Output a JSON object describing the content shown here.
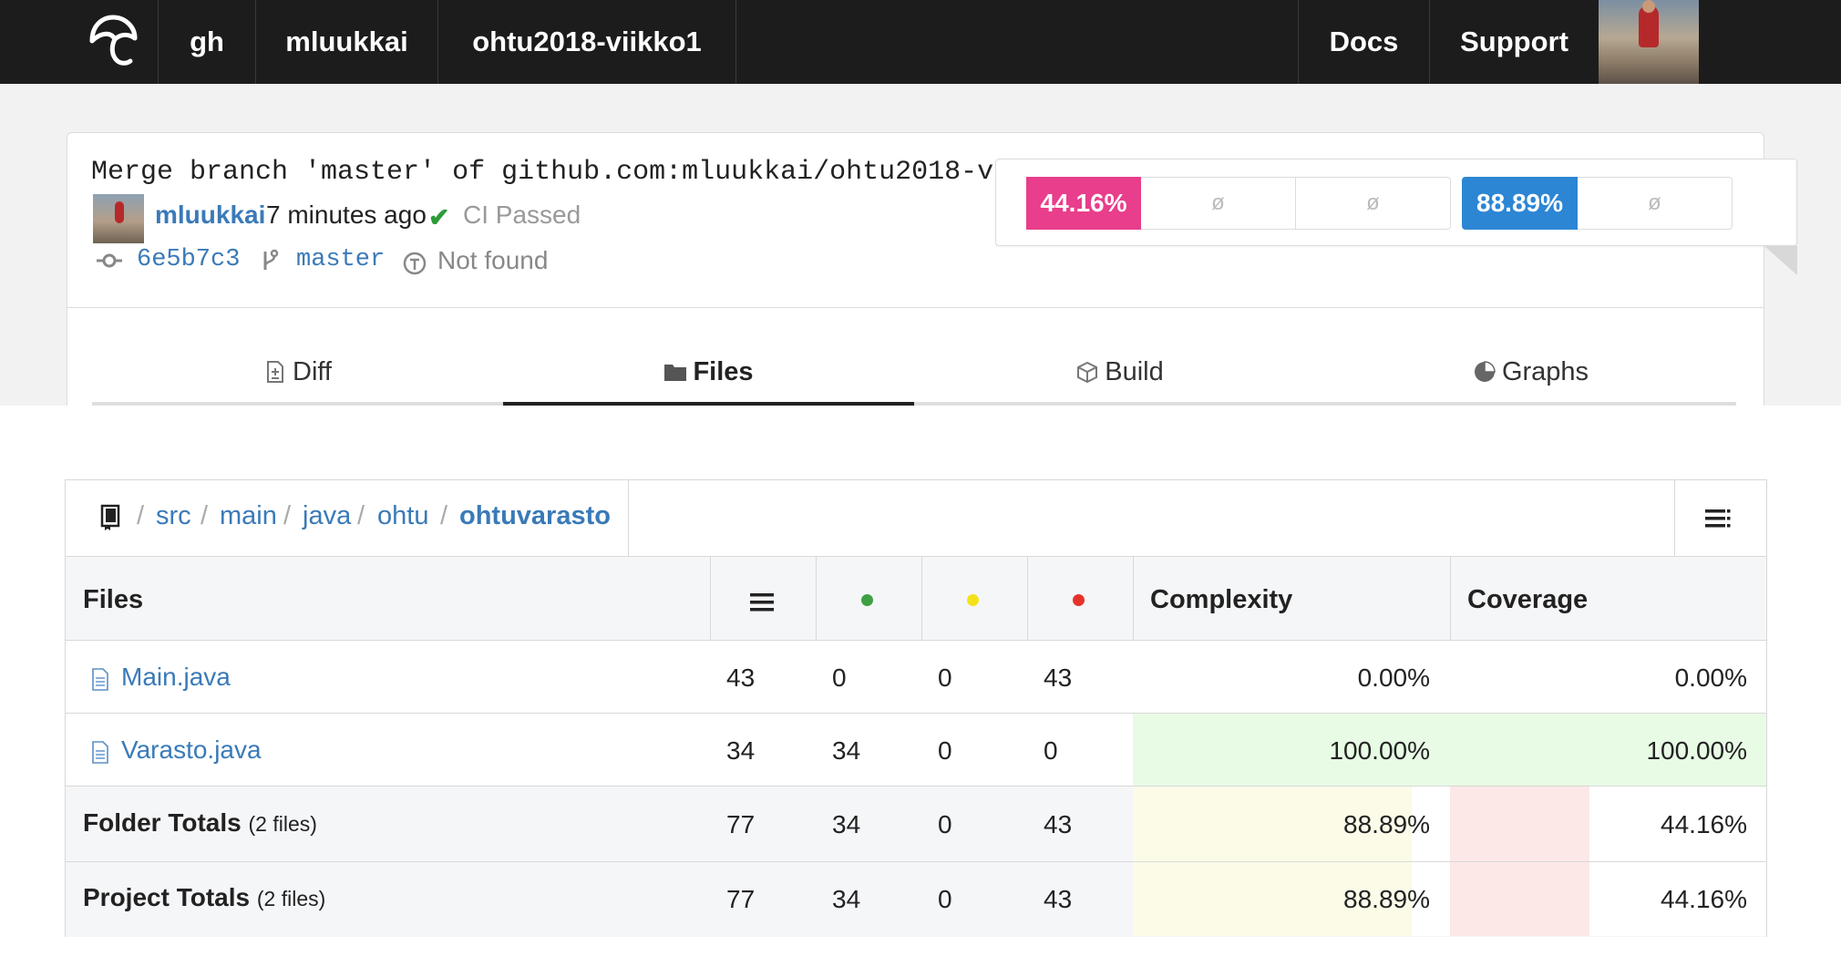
{
  "nav": {
    "logo_icon": "umbrella-logo-icon",
    "gh": "gh",
    "owner": "mluukkai",
    "repo": "ohtu2018-viikko1",
    "docs": "Docs",
    "support": "Support"
  },
  "commit": {
    "message": "Merge branch 'master' of github.com:mluukkai/ohtu2018-viikko1",
    "author": "mluukkai",
    "time": "7 minutes ago",
    "ci_status": "CI Passed",
    "sha": "6e5b7c3",
    "branch": "master",
    "base_status": "Not found"
  },
  "totals": {
    "coverage": "44.16%",
    "change_1": "ø",
    "change_2": "ø",
    "diff_coverage": "88.89%",
    "change_3": "ø"
  },
  "tabs": [
    {
      "label": "Diff",
      "icon": "diff-file-icon"
    },
    {
      "label": "Files",
      "icon": "folder-icon",
      "active": true
    },
    {
      "label": "Build",
      "icon": "box-icon"
    },
    {
      "label": "Graphs",
      "icon": "pie-chart-icon"
    }
  ],
  "breadcrumb": [
    "src",
    "main",
    "java",
    "ohtu",
    "ohtuvarasto"
  ],
  "table": {
    "headers": {
      "files": "Files",
      "complexity": "Complexity",
      "coverage": "Coverage"
    },
    "rows": [
      {
        "name": "Main.java",
        "lines": "43",
        "hits": "0",
        "partials": "0",
        "misses": "43",
        "complexity": "0.00%",
        "coverage": "0.00%"
      },
      {
        "name": "Varasto.java",
        "lines": "34",
        "hits": "34",
        "partials": "0",
        "misses": "0",
        "complexity": "100.00%",
        "coverage": "100.00%"
      }
    ],
    "folder_totals": {
      "label": "Folder Totals",
      "note": "(2 files)",
      "lines": "77",
      "hits": "34",
      "partials": "0",
      "misses": "43",
      "complexity": "88.89%",
      "coverage": "44.16%"
    },
    "project_totals": {
      "label": "Project Totals",
      "note": "(2 files)",
      "lines": "77",
      "hits": "34",
      "partials": "0",
      "misses": "43",
      "complexity": "88.89%",
      "coverage": "44.16%"
    }
  },
  "colors": {
    "coverage_badge": "#e83e8c",
    "diff_badge": "#2c86d4",
    "hit_dot": "#3ea043",
    "partial_dot": "#f5e11a",
    "miss_dot": "#e5332a",
    "full_coverage_bg": "#e8fbe5",
    "partial_bg": "#fbfbe8",
    "low_bg": "#fce8e6"
  }
}
